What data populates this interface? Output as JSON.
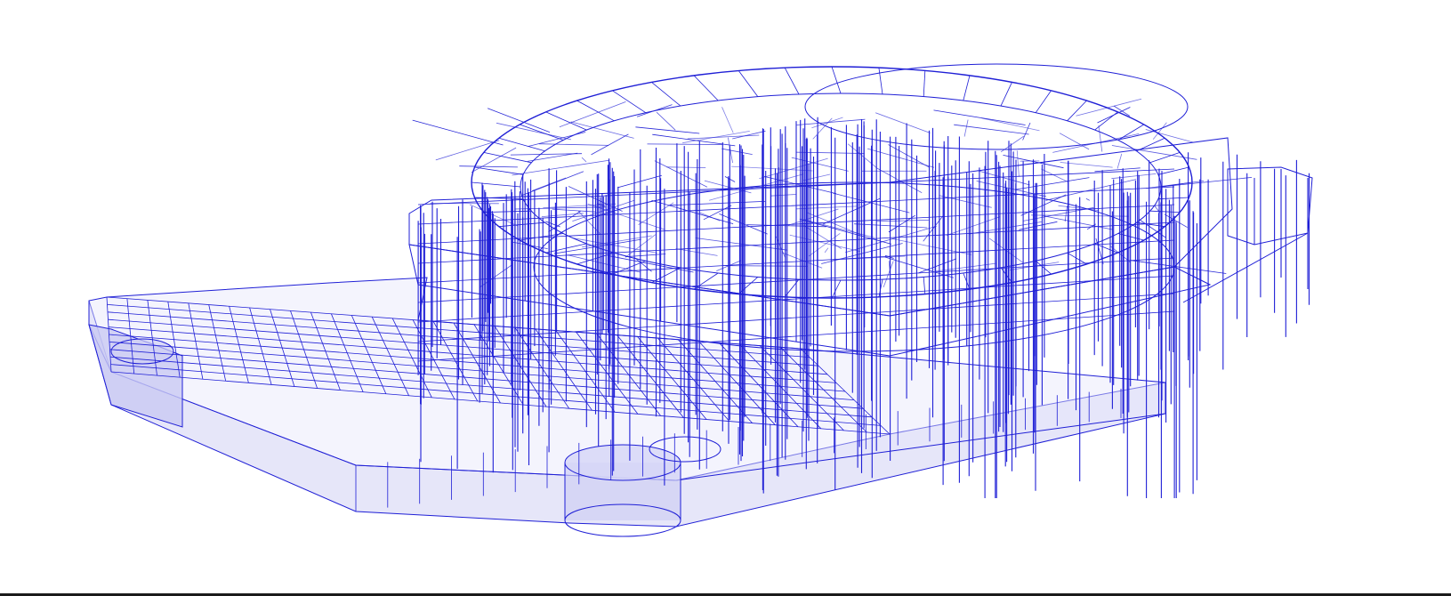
{
  "view": {
    "kind": "3d-wireframe-structural-model",
    "projection": "perspective",
    "colors": {
      "background": "#ffffff",
      "members": "#1f1fd6",
      "members_light": "#6a6ae8",
      "slab_fill": "#dcdcf7",
      "frame_edge": "#1a1a1a"
    }
  }
}
